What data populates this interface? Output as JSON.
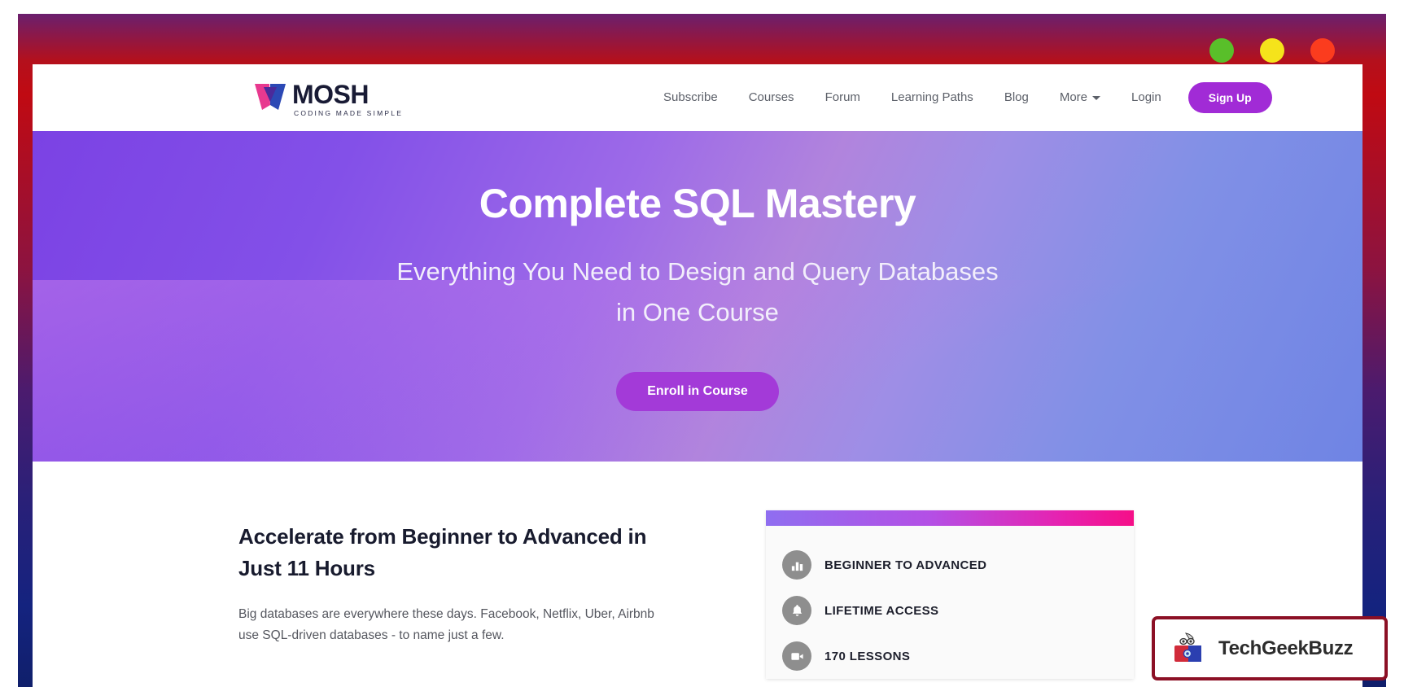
{
  "window": {
    "traffic_lights": [
      {
        "name": "minimize-dot",
        "color": "#59bf2a"
      },
      {
        "name": "maximize-dot",
        "color": "#f5e31b"
      },
      {
        "name": "close-dot",
        "color": "#fb3c1e"
      }
    ],
    "frame_colors": {
      "top": "#c00a12",
      "middle": "#4b1b6e",
      "bottom": "#101f6b"
    }
  },
  "header": {
    "logo": {
      "word": "MOSH",
      "tagline": "CODING MADE SIMPLE"
    },
    "nav": [
      {
        "label": "Subscribe",
        "caret": false
      },
      {
        "label": "Courses",
        "caret": false
      },
      {
        "label": "Forum",
        "caret": false
      },
      {
        "label": "Learning Paths",
        "caret": false
      },
      {
        "label": "Blog",
        "caret": false
      },
      {
        "label": "More",
        "caret": true
      },
      {
        "label": "Login",
        "caret": false
      }
    ],
    "signup_label": "Sign Up",
    "signup_color": "#a12bd6"
  },
  "hero": {
    "title": "Complete SQL Mastery",
    "subtitle": "Everything You Need to Design and Query Databases in One Course",
    "cta_label": "Enroll in Course",
    "cta_color": "#a33ad8",
    "gradient_from": "#7b42e4",
    "gradient_to": "#6f84e4"
  },
  "main": {
    "heading": "Accelerate from Beginner to Advanced in Just 11 Hours",
    "paragraph": "Big databases are everywhere these days. Facebook, Netflix, Uber, Airbnb use SQL-driven databases - to name just a few.",
    "card": {
      "bar_gradient_from": "#8f6ef0",
      "bar_gradient_to": "#f50f88",
      "features": [
        {
          "icon": "bar-chart-icon",
          "label": "BEGINNER TO ADVANCED"
        },
        {
          "icon": "bell-icon",
          "label": "LIFETIME ACCESS"
        },
        {
          "icon": "video-camera-icon",
          "label": "170 LESSONS"
        }
      ]
    }
  },
  "watermark": {
    "text": "TechGeekBuzz",
    "border_color": "#8c1025"
  }
}
